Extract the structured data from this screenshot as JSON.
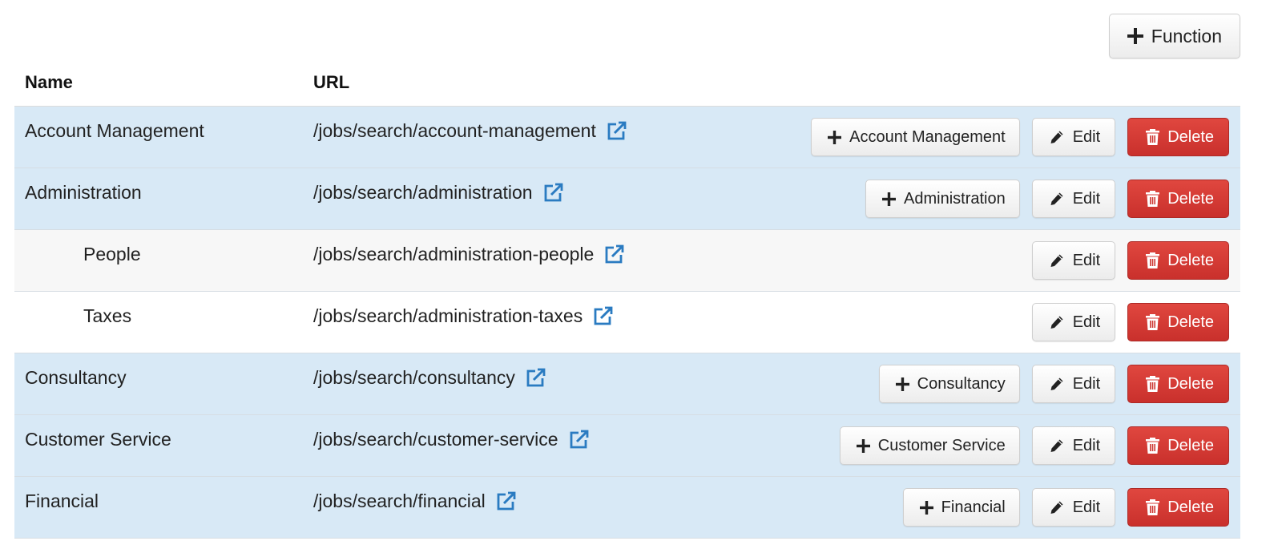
{
  "toolbar": {
    "add_function_label": "Function"
  },
  "table": {
    "columns": {
      "name": "Name",
      "url": "URL"
    },
    "rows": [
      {
        "name": "Account Management",
        "url": "/jobs/search/account-management",
        "add_label": "Account Management",
        "edit_label": "Edit",
        "delete_label": "Delete"
      },
      {
        "name": "Administration",
        "url": "/jobs/search/administration",
        "add_label": "Administration",
        "edit_label": "Edit",
        "delete_label": "Delete"
      },
      {
        "name": "People",
        "url": "/jobs/search/administration-people",
        "edit_label": "Edit",
        "delete_label": "Delete"
      },
      {
        "name": "Taxes",
        "url": "/jobs/search/administration-taxes",
        "edit_label": "Edit",
        "delete_label": "Delete"
      },
      {
        "name": "Consultancy",
        "url": "/jobs/search/consultancy",
        "add_label": "Consultancy",
        "edit_label": "Edit",
        "delete_label": "Delete"
      },
      {
        "name": "Customer Service",
        "url": "/jobs/search/customer-service",
        "add_label": "Customer Service",
        "edit_label": "Edit",
        "delete_label": "Delete"
      },
      {
        "name": "Financial",
        "url": "/jobs/search/financial",
        "add_label": "Financial",
        "edit_label": "Edit",
        "delete_label": "Delete"
      }
    ]
  },
  "icons": {
    "add": "plus-icon",
    "edit": "pencil-icon",
    "delete": "trash-icon",
    "external": "external-link-icon"
  },
  "colors": {
    "row_highlight": "#d8e9f6",
    "row_child_alt": "#f7f7f7",
    "link_icon": "#2a7bc1",
    "danger": "#d9534f"
  }
}
